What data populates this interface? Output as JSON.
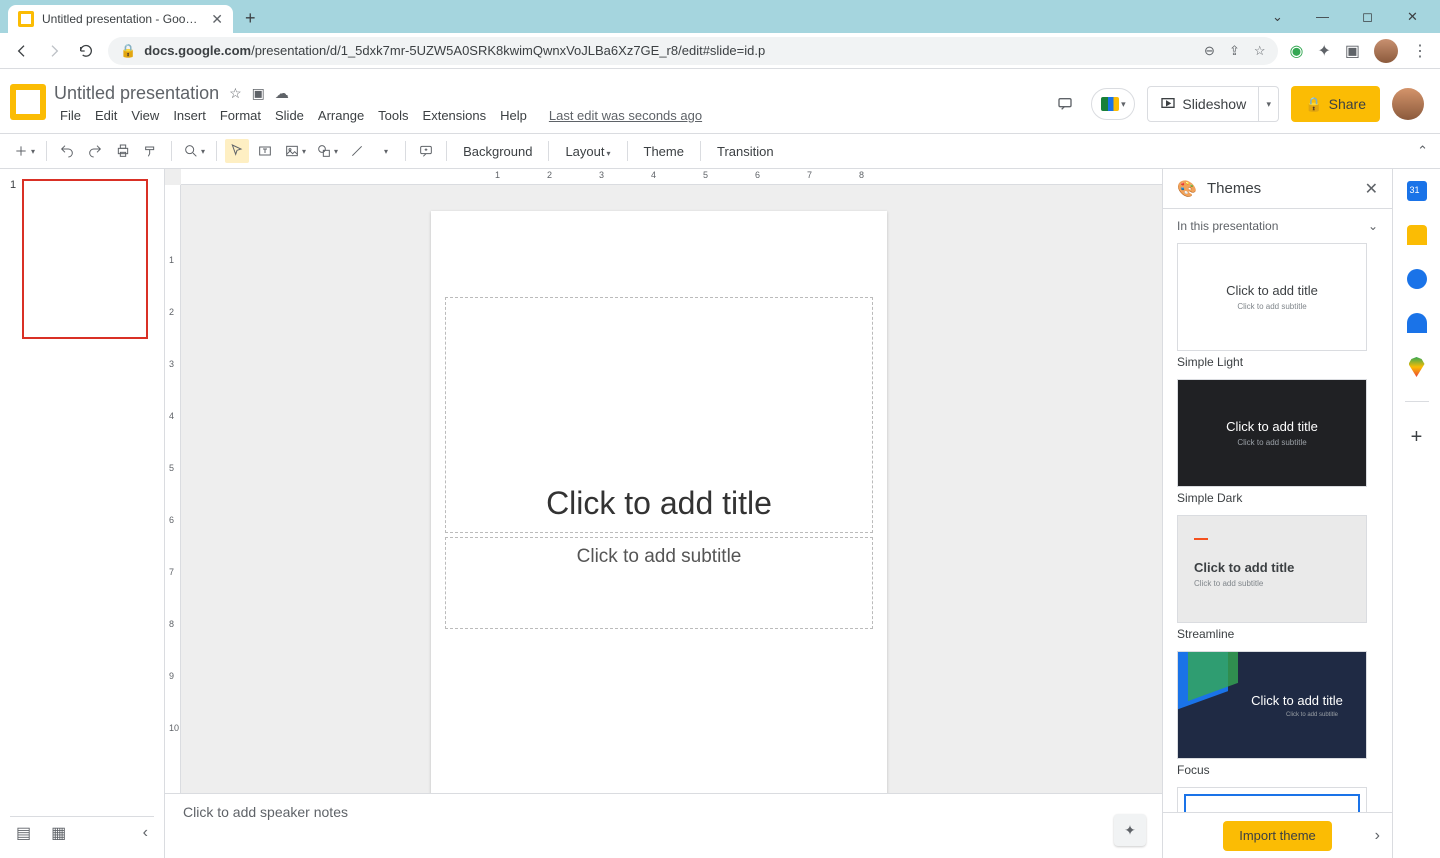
{
  "browser": {
    "tab_title": "Untitled presentation - Google Slides",
    "url_prefix": "docs.google.com",
    "url_path": "/presentation/d/1_5dxk7mr-5UZW5A0SRK8kwimQwnxVoJLBa6Xz7GE_r8/edit#slide=id.p"
  },
  "doc": {
    "title": "Untitled presentation",
    "last_edit": "Last edit was seconds ago"
  },
  "menubar": [
    "File",
    "Edit",
    "View",
    "Insert",
    "Format",
    "Slide",
    "Arrange",
    "Tools",
    "Extensions",
    "Help"
  ],
  "header_buttons": {
    "slideshow": "Slideshow",
    "share": "Share"
  },
  "toolbar": {
    "background": "Background",
    "layout": "Layout",
    "theme": "Theme",
    "transition": "Transition"
  },
  "slide": {
    "title_placeholder": "Click to add title",
    "subtitle_placeholder": "Click to add subtitle",
    "notes_placeholder": "Click to add speaker notes"
  },
  "filmstrip": {
    "slide_number": "1"
  },
  "themes_panel": {
    "title": "Themes",
    "section": "In this presentation",
    "import": "Import theme",
    "themes": [
      {
        "name": "Simple Light",
        "title": "Click to add title",
        "sub": "Click to add subtitle"
      },
      {
        "name": "Simple Dark",
        "title": "Click to add title",
        "sub": "Click to add subtitle"
      },
      {
        "name": "Streamline",
        "title": "Click to add title",
        "sub": "Click to add subtitle"
      },
      {
        "name": "Focus",
        "title": "Click to add title",
        "sub": "Click to add subtitle"
      }
    ]
  },
  "ruler_h": [
    "1",
    "2",
    "3",
    "4",
    "5",
    "6",
    "7",
    "8"
  ],
  "ruler_v": [
    "1",
    "2",
    "3",
    "4",
    "5",
    "6",
    "7",
    "8",
    "9",
    "10"
  ]
}
